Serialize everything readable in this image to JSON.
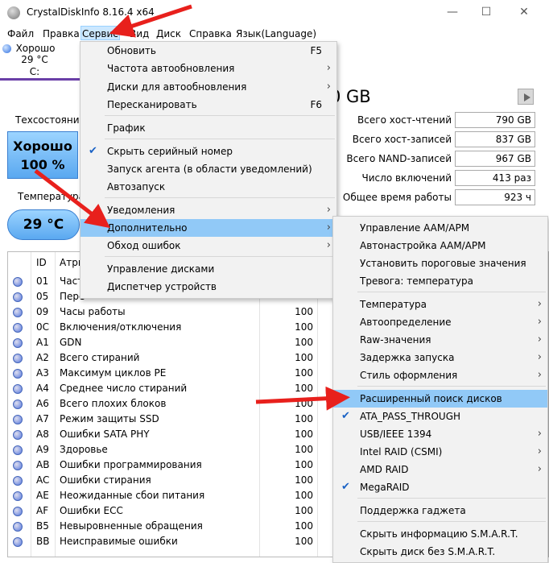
{
  "window": {
    "title": "CrystalDiskInfo 8.16.4 x64",
    "minimize": "—",
    "maximize": "☐",
    "close": "✕"
  },
  "menubar": [
    "Файл",
    "Правка",
    "Сервис",
    "Вид",
    "Диск",
    "Справка",
    "Язык(Language)"
  ],
  "disk_tab": {
    "status": "Хорошо",
    "temp": "29 °C",
    "drive": "C:"
  },
  "left": {
    "health_label": "Техсостояние",
    "health_status": "Хорошо",
    "health_percent": "100 %",
    "temp_label": "Температура",
    "temp_value": "29 °C"
  },
  "disk_size": "0 GB",
  "stats": [
    {
      "label": "Всего хост-чтений",
      "value": "790 GB"
    },
    {
      "label": "Всего хост-записей",
      "value": "837 GB"
    },
    {
      "label": "Всего NAND-записей",
      "value": "967 GB"
    },
    {
      "label": "Число включений",
      "value": "413 раз"
    },
    {
      "label": "Общее время работы",
      "value": "923 ч"
    }
  ],
  "smart": {
    "header_id": "ID",
    "header_name": "Атри",
    "rows": [
      {
        "id": "01",
        "name": "Част",
        "value": ""
      },
      {
        "id": "05",
        "name": "Пере",
        "value": ""
      },
      {
        "id": "09",
        "name": "Часы работы",
        "value": "100"
      },
      {
        "id": "0C",
        "name": "Включения/отключения",
        "value": "100"
      },
      {
        "id": "A1",
        "name": "GDN",
        "value": "100"
      },
      {
        "id": "A2",
        "name": "Всего стираний",
        "value": "100"
      },
      {
        "id": "A3",
        "name": "Максимум циклов PE",
        "value": "100"
      },
      {
        "id": "A4",
        "name": "Среднее число стираний",
        "value": "100"
      },
      {
        "id": "A6",
        "name": "Всего плохих блоков",
        "value": "100"
      },
      {
        "id": "A7",
        "name": "Режим защиты SSD",
        "value": "100"
      },
      {
        "id": "A8",
        "name": "Ошибки SATA PHY",
        "value": "100"
      },
      {
        "id": "A9",
        "name": "Здоровье",
        "value": "100"
      },
      {
        "id": "AB",
        "name": "Ошибки программирования",
        "value": "100"
      },
      {
        "id": "AC",
        "name": "Ошибки стирания",
        "value": "100"
      },
      {
        "id": "AE",
        "name": "Неожиданные сбои питания",
        "value": "100"
      },
      {
        "id": "AF",
        "name": "Ошибки ECC",
        "value": "100"
      },
      {
        "id": "B5",
        "name": "Невыровненные обращения",
        "value": "100"
      },
      {
        "id": "BB",
        "name": "Неисправимые ошибки",
        "value": "100"
      }
    ]
  },
  "service_menu": {
    "items": [
      {
        "label": "Обновить",
        "shortcut": "F5"
      },
      {
        "label": "Частота автообновления",
        "submenu": "›"
      },
      {
        "label": "Диски для автообновления",
        "submenu": "›"
      },
      {
        "label": "Пересканировать",
        "shortcut": "F6"
      },
      {
        "label": "График"
      },
      {
        "label": "Скрыть серийный номер",
        "check": "✔"
      },
      {
        "label": "Запуск агента (в области уведомлений)"
      },
      {
        "label": "Автозапуск"
      },
      {
        "label": "Уведомления",
        "submenu": "›"
      },
      {
        "label": "Дополнительно",
        "submenu": "›"
      },
      {
        "label": "Обход ошибок",
        "submenu": "›"
      },
      {
        "label": "Управление дисками"
      },
      {
        "label": "Диспетчер устройств"
      }
    ]
  },
  "advanced_menu": {
    "items": [
      {
        "label": "Управление AAM/APM"
      },
      {
        "label": "Автонастройка AAM/APM"
      },
      {
        "label": "Установить пороговые значения"
      },
      {
        "label": "Тревога: температура"
      },
      {
        "label": "Температура",
        "submenu": "›"
      },
      {
        "label": "Автоопределение",
        "submenu": "›"
      },
      {
        "label": "Raw-значения",
        "submenu": "›"
      },
      {
        "label": "Задержка запуска",
        "submenu": "›"
      },
      {
        "label": "Стиль оформления",
        "submenu": "›"
      },
      {
        "label": "Расширенный поиск дисков"
      },
      {
        "label": "ATA_PASS_THROUGH",
        "check": "✔"
      },
      {
        "label": "USB/IEEE 1394",
        "submenu": "›"
      },
      {
        "label": "Intel RAID (CSMI)",
        "submenu": "›"
      },
      {
        "label": "AMD RAID",
        "submenu": "›"
      },
      {
        "label": "MegaRAID",
        "check": "✔"
      },
      {
        "label": "Поддержка гаджета"
      },
      {
        "label": "Скрыть информацию S.M.A.R.T."
      },
      {
        "label": "Скрыть диск без S.M.A.R.T."
      }
    ]
  },
  "colors": {
    "highlight": "#91c9f7",
    "arrow": "#e8201c",
    "tab_underline": "#6a3fa7"
  }
}
